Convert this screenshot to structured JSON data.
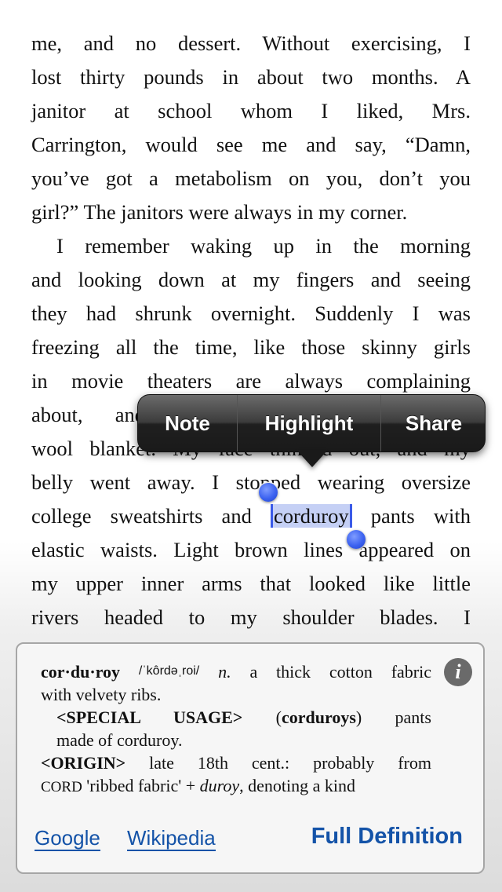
{
  "book": {
    "paragraph1_lines": [
      "me, and no dessert. Without exercising, I",
      "lost thirty pounds in about two months. A",
      "janitor at school whom I liked, Mrs.",
      "Carrington, would see me and say, “Damn,",
      "you’ve got a metabolism on you, don’t you",
      "girl?” The janitors were always in my corner."
    ],
    "paragraph2_lines": [
      "I remember waking up in the morning",
      "and looking down at my fingers and seeing",
      "they had shrunk overnight. Suddenly I was",
      "freezing all the time, like those skinny girls",
      "in movie theaters are always complaining",
      "about, and wrapping themselves in a",
      "wool blanket. My face thinned out, and my",
      "belly went away. I stopped wearing oversize"
    ],
    "selection_line": {
      "before": "college sweatshirts and ",
      "selected": "corduroy",
      "after": " pants with"
    },
    "paragraph2_rest": [
      "elastic waists. Light brown lines appeared on",
      "my upper inner arms that looked like little",
      "rivers headed to my shoulder blades. I"
    ],
    "selection_color": "#c5d0f5",
    "handle_color": "#3c62f0"
  },
  "context_menu": {
    "items": [
      "Note",
      "Highlight",
      "Share"
    ]
  },
  "dictionary": {
    "headword": "cor·du·roy",
    "pronunciation": "/ˈkôrdəˌroi/",
    "pos": "n.",
    "definition_1": "a thick cotton fabric",
    "definition_2": "with velvety ribs.",
    "special_usage_label": "<SPECIAL USAGE>",
    "special_usage_open": "(",
    "special_usage_word": "corduroys",
    "special_usage_close": ")",
    "special_usage_def_1": "pants",
    "special_usage_def_2": "made of corduroy.",
    "origin_label": "<ORIGIN>",
    "origin_text_1": "late 18th cent.: probably from",
    "origin_cord": "CORD",
    "origin_text_2": "'ribbed fabric' + ",
    "origin_duroy": "duroy",
    "origin_text_3": ", denoting a kind",
    "info_icon": "i",
    "links": {
      "google": "Google",
      "wikipedia": "Wikipedia",
      "full_definition": "Full Definition"
    },
    "link_color": "#1453a8"
  }
}
